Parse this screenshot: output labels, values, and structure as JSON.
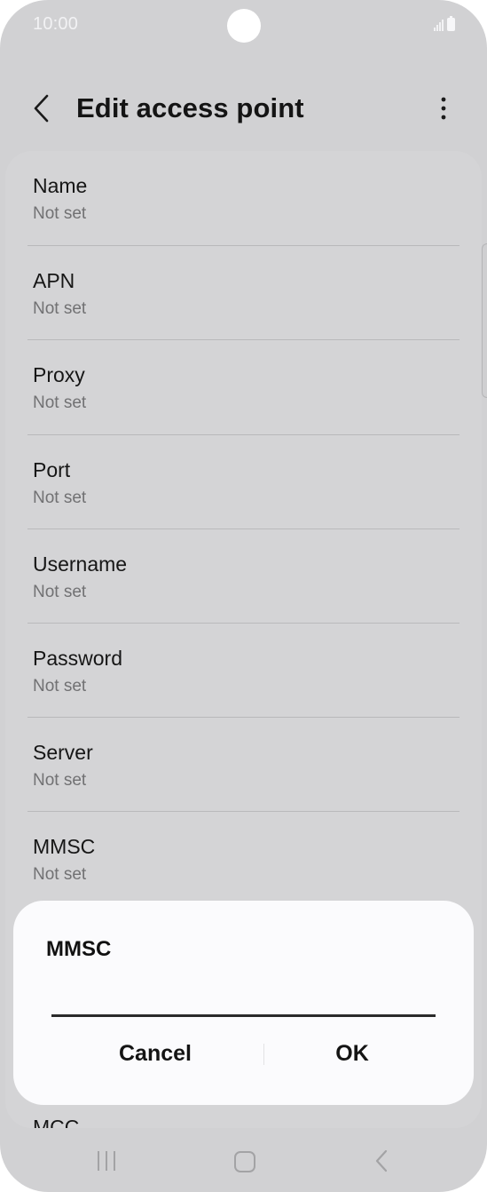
{
  "status_bar": {
    "time": "10:00"
  },
  "app_bar": {
    "title": "Edit access point",
    "back_icon": "chevron-left-icon",
    "more_icon": "more-vertical-icon"
  },
  "fields": [
    {
      "label": "Name",
      "value": "Not set"
    },
    {
      "label": "APN",
      "value": "Not set"
    },
    {
      "label": "Proxy",
      "value": "Not set"
    },
    {
      "label": "Port",
      "value": "Not set"
    },
    {
      "label": "Username",
      "value": "Not set"
    },
    {
      "label": "Password",
      "value": "Not set"
    },
    {
      "label": "Server",
      "value": "Not set"
    },
    {
      "label": "MMSC",
      "value": "Not set"
    },
    {
      "label": "MCC",
      "value": ""
    }
  ],
  "dialog": {
    "title": "MMSC",
    "input_value": "",
    "cancel_label": "Cancel",
    "ok_label": "OK"
  },
  "nav_bar": {
    "recents_icon": "recents-icon",
    "home_icon": "home-icon",
    "back_icon": "back-icon"
  },
  "colors": {
    "background_dim": "#d1d1d3",
    "dialog_bg": "#fbfbfd",
    "subtitle": "#717173"
  }
}
